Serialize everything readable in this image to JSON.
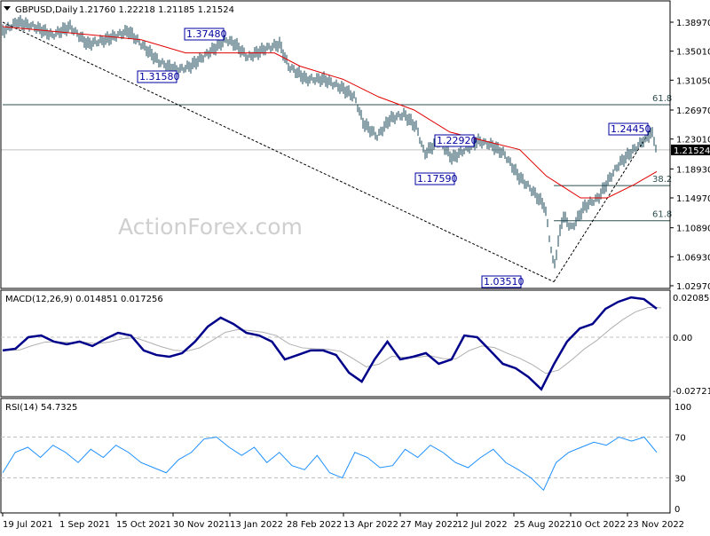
{
  "header": {
    "symbol": "GBPUSD,Daily",
    "ohlc": "1.21760 1.22218 1.21185 1.21524"
  },
  "watermark": "ActionForex.com",
  "colors": {
    "bars": "#1b4757",
    "ma": "#e00000",
    "macd": "#00008b",
    "signal": "#b0b0b0",
    "rsi": "#1e90ff",
    "label": "#0000a0"
  },
  "chart_data": [
    {
      "type": "ohlc",
      "title": "GBPUSD,Daily",
      "date_range": [
        "2021-07-19",
        "2022-12-16"
      ],
      "ylim": [
        1.0257,
        1.4137
      ],
      "y_ticks": [
        "1.38970",
        "1.35010",
        "1.31050",
        "1.26970",
        "1.23010",
        "1.18930",
        "1.14970",
        "1.10890",
        "1.06930",
        "1.02970"
      ],
      "x_ticks": [
        "19 Jul 2021",
        "1 Sep 2021",
        "15 Oct 2021",
        "30 Nov 2021",
        "13 Jan 2022",
        "28 Feb 2022",
        "13 Apr 2022",
        "27 May 2022",
        "12 Jul 2022",
        "25 Aug 2022",
        "10 Oct 2022",
        "23 Nov 2022"
      ],
      "last_price": "1.21524",
      "price": [
        [
          "2021-07-20",
          1.3777
        ],
        [
          "2021-07-30",
          1.3897
        ],
        [
          "2021-08-13",
          1.3837
        ],
        [
          "2021-08-27",
          1.3717
        ],
        [
          "2021-09-10",
          1.3837
        ],
        [
          "2021-09-24",
          1.3597
        ],
        [
          "2021-10-08",
          1.3657
        ],
        [
          "2021-10-26",
          1.3777
        ],
        [
          "2021-11-05",
          1.3597
        ],
        [
          "2021-11-19",
          1.3357
        ],
        [
          "2021-12-03",
          1.3237
        ],
        [
          "2021-12-14",
          1.3297
        ],
        [
          "2021-12-28",
          1.3477
        ],
        [
          "2022-01-11",
          1.3657
        ],
        [
          "2022-01-18",
          1.3597
        ],
        [
          "2022-01-28",
          1.3417
        ],
        [
          "2022-02-11",
          1.3537
        ],
        [
          "2022-02-22",
          1.3597
        ],
        [
          "2022-03-01",
          1.3297
        ],
        [
          "2022-03-15",
          1.3117
        ],
        [
          "2022-03-29",
          1.3117
        ],
        [
          "2022-04-12",
          1.2997
        ],
        [
          "2022-04-22",
          1.2877
        ],
        [
          "2022-04-29",
          1.2517
        ],
        [
          "2022-05-10",
          1.2337
        ],
        [
          "2022-05-20",
          1.2577
        ],
        [
          "2022-05-31",
          1.2637
        ],
        [
          "2022-06-10",
          1.2457
        ],
        [
          "2022-06-16",
          1.2097
        ],
        [
          "2022-06-27",
          1.2277
        ],
        [
          "2022-07-08",
          1.2037
        ],
        [
          "2022-07-18",
          1.2157
        ],
        [
          "2022-07-28",
          1.2277
        ],
        [
          "2022-08-08",
          1.2217
        ],
        [
          "2022-08-18",
          1.2097
        ],
        [
          "2022-08-29",
          1.1797
        ],
        [
          "2022-09-08",
          1.1617
        ],
        [
          "2022-09-19",
          1.1377
        ],
        [
          "2022-09-26",
          1.0537
        ],
        [
          "2022-10-03",
          1.1257
        ],
        [
          "2022-10-10",
          1.1077
        ],
        [
          "2022-10-20",
          1.1377
        ],
        [
          "2022-10-31",
          1.1497
        ],
        [
          "2022-11-10",
          1.1797
        ],
        [
          "2022-11-17",
          1.1977
        ],
        [
          "2022-11-28",
          1.2157
        ],
        [
          "2022-12-05",
          1.2277
        ],
        [
          "2022-12-12",
          1.2397
        ],
        [
          "2022-12-16",
          1.2152
        ]
      ],
      "moving_average": [
        [
          "2021-07-19",
          1.3837
        ],
        [
          "2021-10-01",
          1.3717
        ],
        [
          "2021-11-05",
          1.3657
        ],
        [
          "2021-12-10",
          1.3477
        ],
        [
          "2022-01-22",
          1.3477
        ],
        [
          "2022-02-18",
          1.3477
        ],
        [
          "2022-03-10",
          1.3297
        ],
        [
          "2022-04-13",
          1.3117
        ],
        [
          "2022-05-11",
          1.2877
        ],
        [
          "2022-06-08",
          1.2697
        ],
        [
          "2022-07-06",
          1.2397
        ],
        [
          "2022-08-02",
          1.2277
        ],
        [
          "2022-08-30",
          1.2157
        ],
        [
          "2022-09-20",
          1.1797
        ],
        [
          "2022-10-17",
          1.1497
        ],
        [
          "2022-11-07",
          1.1497
        ],
        [
          "2022-11-28",
          1.1677
        ],
        [
          "2022-12-16",
          1.1857
        ]
      ],
      "levels": [
        {
          "label": "61.8",
          "price": 1.2769,
          "from": "2021-07-19"
        },
        {
          "label": "38.2",
          "price": 1.1665,
          "from": "2022-09-26"
        },
        {
          "label": "61.8",
          "price": 1.1185,
          "from": "2022-09-26"
        }
      ],
      "trendlines": [
        {
          "from": [
            "2021-07-19",
            1.3897
          ],
          "to": [
            "2022-09-26",
            1.0351
          ]
        },
        {
          "from": [
            "2022-09-26",
            1.0351
          ],
          "to": [
            "2022-12-12",
            1.2445
          ]
        }
      ],
      "annotations": [
        {
          "text": "1.37480",
          "date": "2022-01-05",
          "price": 1.3748
        },
        {
          "text": "1.31580",
          "date": "2021-12-08",
          "price": 1.3158
        },
        {
          "text": "1.22920",
          "date": "2022-06-27",
          "price": 1.2292
        },
        {
          "text": "1.17590",
          "date": "2022-07-14",
          "price": 1.1759
        },
        {
          "text": "1.03510",
          "date": "2022-09-26",
          "price": 1.0351
        },
        {
          "text": "1.24450",
          "date": "2022-12-12",
          "price": 1.2445
        }
      ]
    },
    {
      "type": "line",
      "title": "MACD(12,26,9) 0.014851 0.017256",
      "ylim": [
        -0.027213,
        0.020858
      ],
      "y_ticks": [
        "0.020858",
        "0.00",
        "-0.027213"
      ],
      "macd": [
        -0.0069,
        -0.006,
        0.0,
        0.0009,
        -0.0023,
        -0.0037,
        -0.0023,
        -0.0046,
        -0.0009,
        0.0023,
        0.0009,
        -0.0069,
        -0.0093,
        -0.0102,
        -0.0083,
        -0.0023,
        0.0056,
        0.0102,
        0.0069,
        0.0023,
        0.0009,
        -0.0023,
        -0.0116,
        -0.0093,
        -0.0069,
        -0.0069,
        -0.0093,
        -0.0185,
        -0.0232,
        -0.0116,
        -0.0023,
        -0.0116,
        -0.0102,
        -0.0083,
        -0.0139,
        -0.0116,
        0.0009,
        0.0,
        -0.0069,
        -0.0139,
        -0.0162,
        -0.0208,
        -0.0272,
        -0.0139,
        -0.0023,
        0.0046,
        0.0069,
        0.0148,
        0.0185,
        0.0208,
        0.0199,
        0.0149
      ]
    },
    {
      "type": "line",
      "title": "RSI(14) 54.7325",
      "ylim": [
        0,
        100
      ],
      "y_ticks": [
        "100",
        "70",
        "30",
        "0"
      ],
      "rsi": [
        35,
        55,
        60,
        50,
        62,
        55,
        45,
        58,
        50,
        62,
        55,
        45,
        40,
        35,
        48,
        55,
        68,
        70,
        60,
        52,
        60,
        45,
        55,
        42,
        38,
        52,
        35,
        30,
        55,
        50,
        40,
        42,
        58,
        50,
        62,
        55,
        45,
        40,
        50,
        58,
        45,
        38,
        30,
        18,
        45,
        55,
        60,
        65,
        62,
        70,
        66,
        70,
        55
      ]
    }
  ]
}
